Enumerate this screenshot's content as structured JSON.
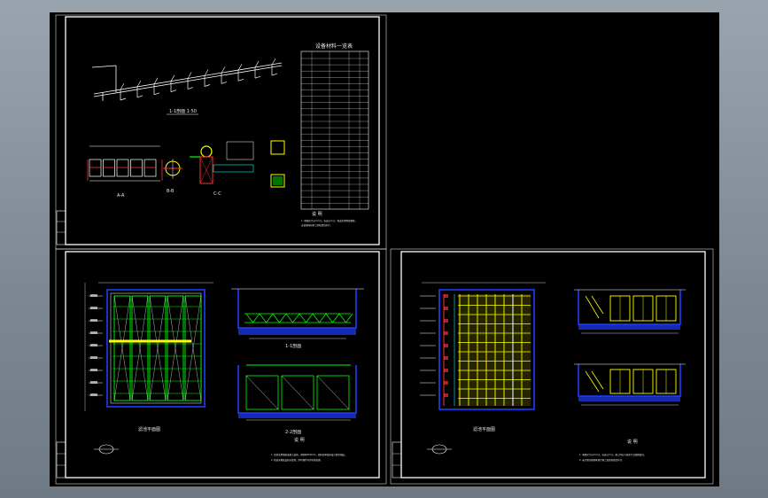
{
  "viewport": {
    "background": "#000000",
    "frame_color": "#ffffff"
  },
  "sheet_top": {
    "table_title": "设备材料一览表",
    "label_pipe": "1-1剖面 1:50",
    "label_left": "A-A",
    "label_mid": "B-B",
    "label_right": "C-C",
    "note_title": "说 明",
    "note_1": "1. 本图尺寸以mm计，标高以m计，管道采用焊接钢管，",
    "note_2": "   安装按国标施工验收规范执行。"
  },
  "sheet_left": {
    "plan_label": "滤池平面图",
    "sect1_label": "1-1剖面",
    "sect2_label": "2-2剖面",
    "note_title": "说 明",
    "note_1": "1. 滤池采用钢筋混凝土结构，池壁厚300mm，滤料层厚度按设计要求铺设，",
    "note_2": "2. 管道穿墙处设防水套管，所有钢件均作防腐处理。"
  },
  "sheet_right": {
    "plan_label": "滤池平面图",
    "note_title": "说 明",
    "note_1": "1. 本图尺寸以mm计，标高以m计，施工时应与相关专业图纸配合，",
    "note_2": "2. 未尽事宜按国家现行施工及验收规范执行。"
  },
  "colors": {
    "white": "#ffffff",
    "yellow": "#ffff00",
    "green": "#00ff00",
    "blue": "#1e3cff",
    "cyan": "#00ffff",
    "red": "#ff3030",
    "magenta": "#ff00ff"
  }
}
